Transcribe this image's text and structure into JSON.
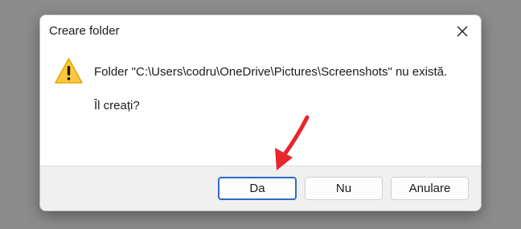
{
  "dialog": {
    "title": "Creare folder",
    "message": "Folder \"C:\\Users\\codru\\OneDrive\\Pictures\\Screenshots\" nu există.",
    "question": "Îl creați?"
  },
  "buttons": {
    "yes": "Da",
    "no": "Nu",
    "cancel": "Anulare"
  },
  "icons": {
    "warning": "warning-icon",
    "close": "close-icon",
    "annotation": "red-arrow"
  },
  "colors": {
    "warning_fill": "#FFC83D",
    "default_button_border": "#2D6CC4",
    "annotation_arrow": "#E8262B"
  }
}
